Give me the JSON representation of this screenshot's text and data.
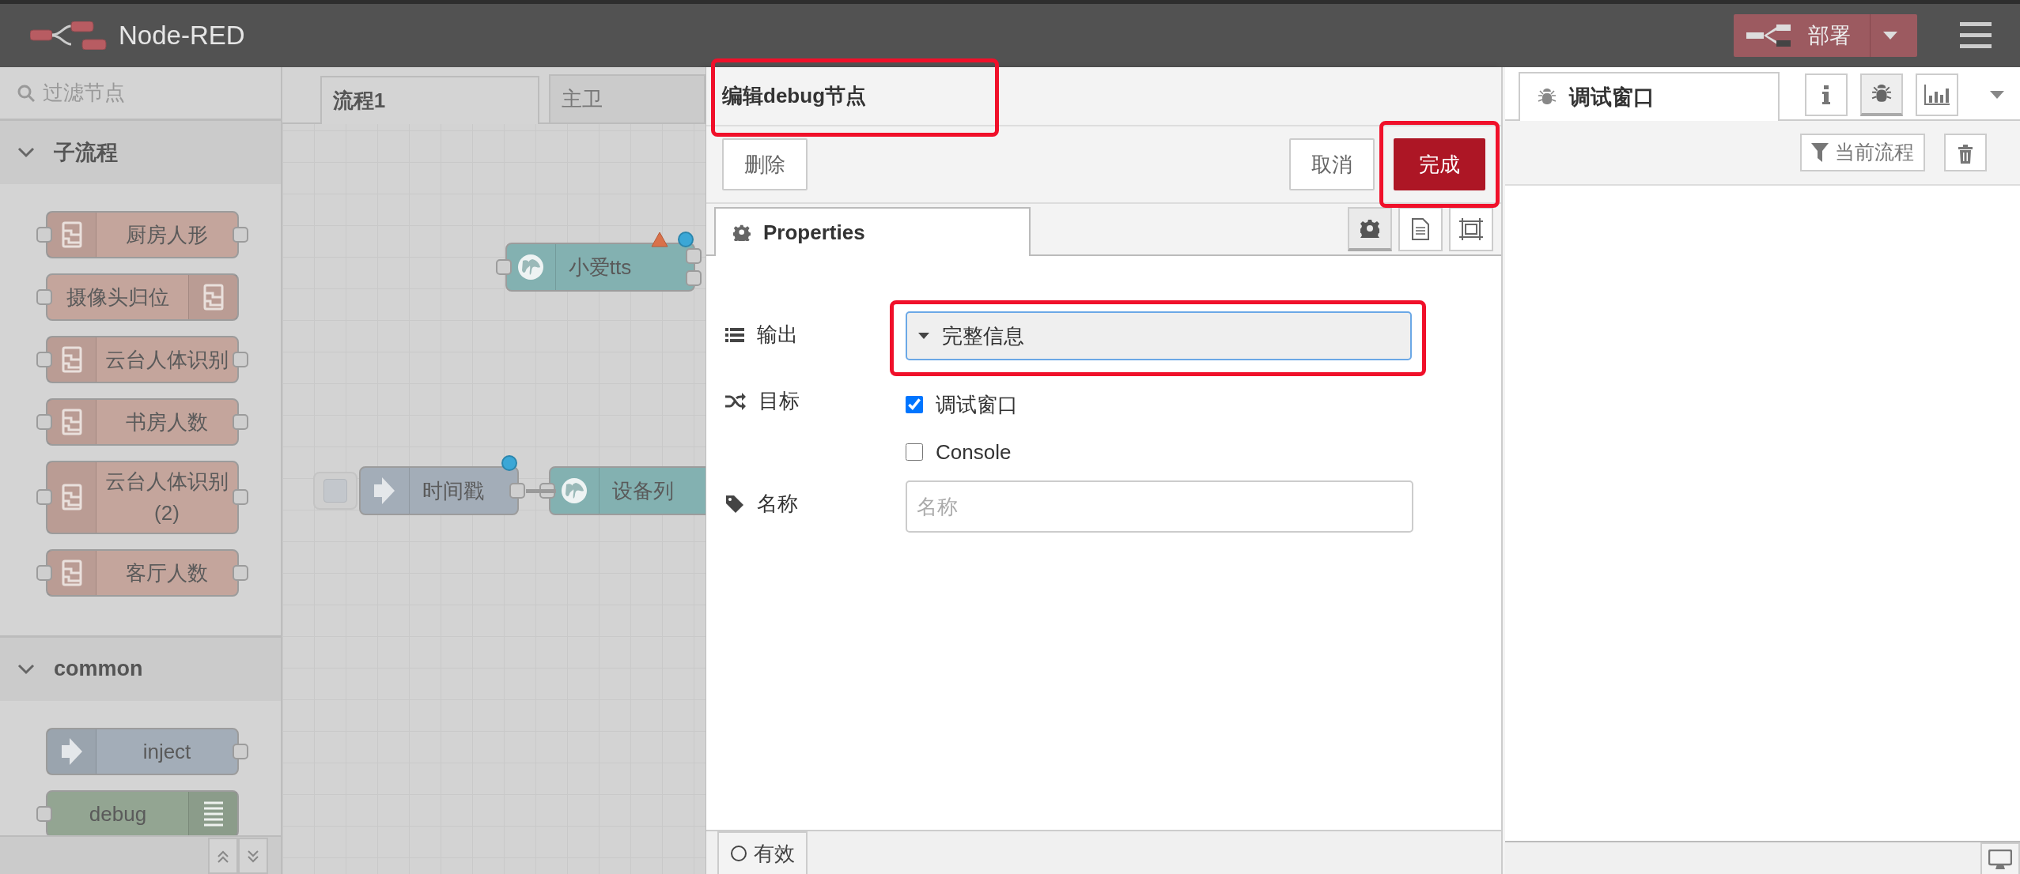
{
  "header": {
    "title": "Node-RED",
    "deploy": "部署"
  },
  "palette": {
    "search_placeholder": "过滤节点",
    "categories": [
      {
        "name": "子流程",
        "expanded": true,
        "nodes": [
          {
            "label": "厨房人形",
            "kind": "subflow",
            "input": true,
            "output": true
          },
          {
            "label": "摄像头归位",
            "kind": "subflow",
            "input": true,
            "output": false
          },
          {
            "label": "云台人体识别",
            "kind": "subflow",
            "input": true,
            "output": true
          },
          {
            "label": "书房人数",
            "kind": "subflow",
            "input": true,
            "output": true
          },
          {
            "label": "云台人体识别 (2)",
            "kind": "subflow",
            "input": true,
            "output": true
          },
          {
            "label": "客厅人数",
            "kind": "subflow",
            "input": true,
            "output": true
          }
        ]
      },
      {
        "name": "common",
        "expanded": true,
        "nodes": [
          {
            "label": "inject",
            "kind": "inject",
            "input": false,
            "output": true
          },
          {
            "label": "debug",
            "kind": "debug",
            "input": true,
            "output": false
          }
        ]
      }
    ]
  },
  "workspace": {
    "tabs": [
      {
        "label": "流程1",
        "selected": true
      },
      {
        "label": "主卫",
        "selected": false
      }
    ],
    "nodes": [
      {
        "label": "小爱tts",
        "kind": "http",
        "warning": true,
        "changed": true,
        "inject_button": false
      },
      {
        "label": "时间戳",
        "kind": "inject",
        "warning": false,
        "changed": true,
        "inject_button": true
      },
      {
        "label": "设备列",
        "kind": "http",
        "warning": false,
        "changed": false,
        "inject_button": false
      }
    ]
  },
  "editor": {
    "title": "编辑debug节点",
    "title_highlighted": true,
    "buttons": [
      {
        "label": "删除",
        "kind": "delete",
        "highlighted": false
      },
      {
        "label": "取消",
        "kind": "cancel",
        "highlighted": false
      },
      {
        "label": "完成",
        "kind": "primary",
        "highlighted": true
      }
    ],
    "tabs": [
      {
        "label": "Properties",
        "selected": true
      }
    ],
    "icon_tabs": [
      {
        "kind": "settings",
        "selected": true
      },
      {
        "kind": "description",
        "selected": false
      },
      {
        "kind": "appearance",
        "selected": false
      }
    ],
    "fields": [
      {
        "kind": "select",
        "label": "输出",
        "value": "完整信息",
        "highlighted": true
      },
      {
        "kind": "checks",
        "label": "目标",
        "options": [
          {
            "label": "调试窗口",
            "checked": true
          },
          {
            "label": "Console",
            "checked": false
          }
        ]
      },
      {
        "kind": "text",
        "label": "名称",
        "placeholder": "名称"
      }
    ],
    "footer": {
      "label": "有效"
    }
  },
  "sidebar": {
    "tabs": [
      {
        "label": "调试窗口",
        "selected": true
      }
    ],
    "icon_tabs": [
      {
        "kind": "info",
        "selected": false
      },
      {
        "kind": "debug",
        "selected": true
      },
      {
        "kind": "chart",
        "selected": false
      }
    ],
    "filter": "当前流程"
  }
}
